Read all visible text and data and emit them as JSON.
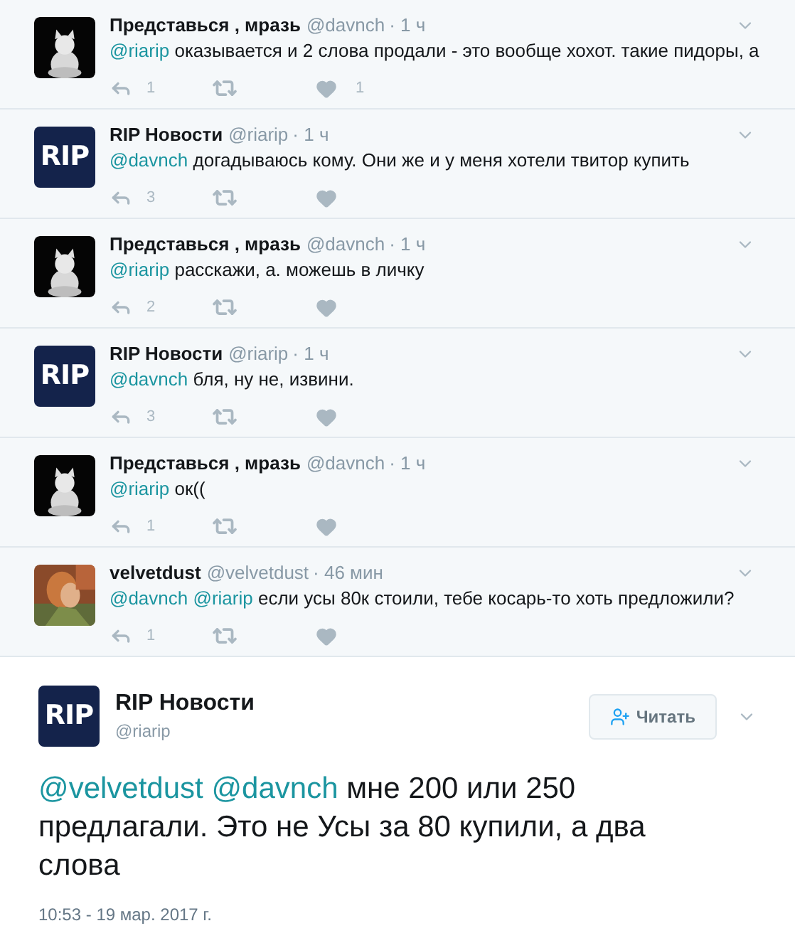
{
  "replies": [
    {
      "name": "Представься , мразь",
      "handle": "@davnch",
      "time": "· 1 ч",
      "avatar": {
        "kind": "cat"
      },
      "mentions": [
        "@riarip"
      ],
      "text": "оказывается и 2 слова продали - это вообще хохот. такие пидоры, а",
      "reply_count": "1",
      "like_count": "1"
    },
    {
      "name": "RIP Новости",
      "handle": "@riarip",
      "time": "· 1 ч",
      "avatar": {
        "kind": "logo",
        "text": "RIP"
      },
      "mentions": [
        "@davnch"
      ],
      "text": "догадываюсь кому. Они же и у меня хотели твитор купить",
      "reply_count": "3"
    },
    {
      "name": "Представься , мразь",
      "handle": "@davnch",
      "time": "· 1 ч",
      "avatar": {
        "kind": "cat"
      },
      "mentions": [
        "@riarip"
      ],
      "text": "расскажи, а. можешь в личку",
      "reply_count": "2"
    },
    {
      "name": "RIP Новости",
      "handle": "@riarip",
      "time": "· 1 ч",
      "avatar": {
        "kind": "logo",
        "text": "RIP"
      },
      "mentions": [
        "@davnch"
      ],
      "text": "бля, ну не, извини.",
      "reply_count": "3"
    },
    {
      "name": "Представься , мразь",
      "handle": "@davnch",
      "time": "· 1 ч",
      "avatar": {
        "kind": "cat"
      },
      "mentions": [
        "@riarip"
      ],
      "text": "ок((",
      "reply_count": "1"
    },
    {
      "name": "velvetdust",
      "handle": "@velvetdust",
      "time": "· 46 мин",
      "mentions": [
        "@davnch",
        "@riarip"
      ],
      "text": "если усы 80к стоили, тебе косарь-то хоть предложили?",
      "reply_count": "1"
    }
  ],
  "main_tweet": {
    "name": "RIP Новости",
    "handle": "@riarip",
    "avatar": {
      "kind": "logo",
      "text": "RIP"
    },
    "follow_button": "Читать",
    "mentions": [
      "@velvetdust",
      "@davnch"
    ],
    "text": "мне 200 или 250 предлагали. Это не Усы за 80 купили, а два слова",
    "timestamp": "10:53 - 19 мар. 2017 г."
  }
}
